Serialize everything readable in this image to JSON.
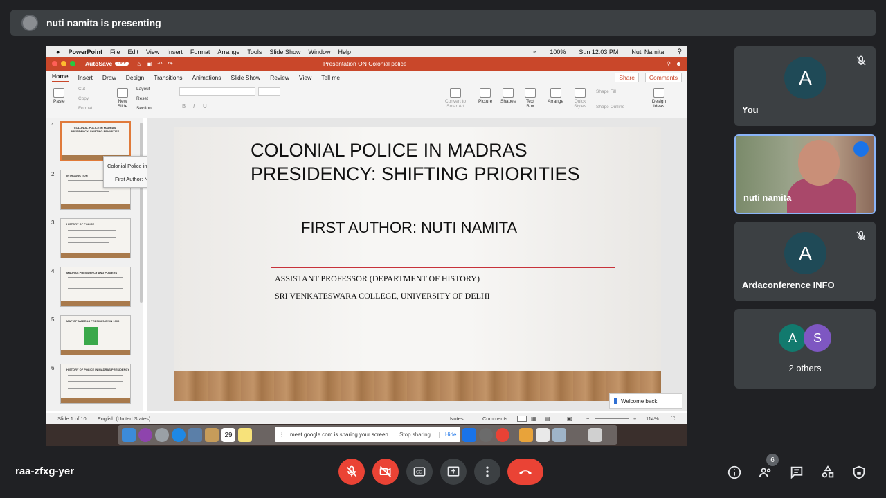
{
  "meet": {
    "presenting_text": "nuti namita is presenting",
    "meeting_code": "raa-zfxg-yer",
    "participant_count": "6",
    "accent_red": "#ea4335",
    "accent_blue": "#8ab4f8"
  },
  "tiles": [
    {
      "name": "You",
      "avatar": "A",
      "muted": true
    },
    {
      "name": "nuti namita",
      "speaking": true
    },
    {
      "name": "Ardaconference INFO",
      "avatar": "A",
      "muted": true
    },
    {
      "name": "2 others",
      "avatars": [
        "A",
        "S"
      ]
    }
  ],
  "mac_menubar": {
    "app": "PowerPoint",
    "menus": [
      "File",
      "Edit",
      "View",
      "Insert",
      "Format",
      "Arrange",
      "Tools",
      "Slide Show",
      "Window",
      "Help"
    ],
    "battery": "100%",
    "clock": "Sun 12:03 PM",
    "user": "Nuti Namita"
  },
  "powerpoint": {
    "autosave_label": "AutoSave",
    "autosave_state": "OFF",
    "doc_title": "Presentation ON Colonial police",
    "tabs": [
      "Home",
      "Insert",
      "Draw",
      "Design",
      "Transitions",
      "Animations",
      "Slide Show",
      "Review",
      "View",
      "Tell me"
    ],
    "share_label": "Share",
    "comments_label": "Comments",
    "ribbon": {
      "paste": "Paste",
      "cut": "Cut",
      "copy": "Copy",
      "format": "Format",
      "new_slide": "New Slide",
      "layout": "Layout",
      "reset": "Reset",
      "section": "Section",
      "convert_smartart": "Convert to SmartArt",
      "picture": "Picture",
      "shapes": "Shapes",
      "text_box": "Text Box",
      "arrange": "Arrange",
      "quick_styles": "Quick Styles",
      "shape_fill": "Shape Fill",
      "shape_outline": "Shape Outline",
      "design_ideas": "Design Ideas"
    },
    "thumbnails": [
      {
        "num": "1",
        "title": "COLONIAL POLICE IN MADRAS PRESIDENCY: SHIFTING PRIORITIES"
      },
      {
        "num": "2",
        "title": "INTRODUCTION"
      },
      {
        "num": "3",
        "title": "HISTORY OF POLICE"
      },
      {
        "num": "4",
        "title": "MADRAS PRESIDENCY AND POWERS"
      },
      {
        "num": "5",
        "title": "MAP OF MADRAS PRESIDENCY IN 1909"
      },
      {
        "num": "6",
        "title": "HISTORY OF POLICE IN MADRAS PRESIDENCY"
      }
    ],
    "tooltip": {
      "line1": "Colonial Police in Madras Presidency: Shifting Priorities",
      "line2": "First Author: Nuti Namita"
    },
    "slide": {
      "title_line1": "COLONIAL POLICE IN MADRAS",
      "title_line2": "PRESIDENCY: SHIFTING PRIORITIES",
      "author": "FIRST AUTHOR: NUTI NAMITA",
      "affiliation1": "ASSISTANT PROFESSOR (DEPARTMENT OF HISTORY)",
      "affiliation2": "SRI VENKATESWARA COLLEGE, UNIVERSITY OF DELHI"
    },
    "welcome": "Welcome back!",
    "status": {
      "slide_of": "Slide 1 of 10",
      "language": "English (United States)",
      "notes": "Notes",
      "comments": "Comments",
      "zoom": "114%"
    }
  },
  "screenshare_popup": {
    "message": "meet.google.com is sharing your screen.",
    "stop": "Stop sharing",
    "hide": "Hide"
  },
  "dock": {
    "calendar_day": "29"
  }
}
